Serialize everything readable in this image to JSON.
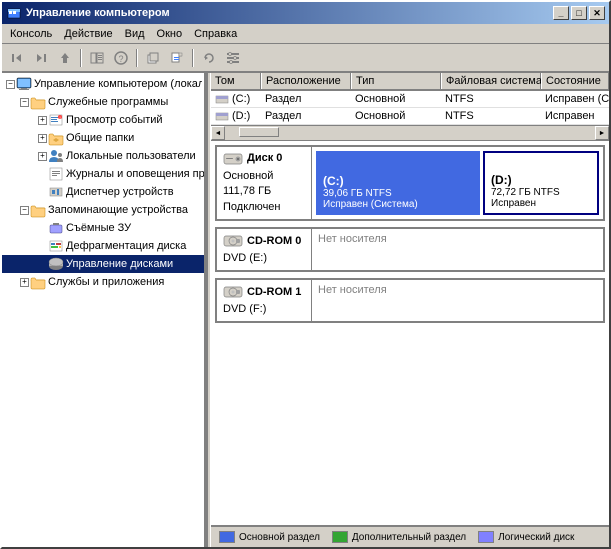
{
  "window": {
    "title": "Управление компьютером",
    "minimize_label": "_",
    "maximize_label": "□",
    "close_label": "✕"
  },
  "menu": {
    "items": [
      "Консоль",
      "Действие",
      "Вид",
      "Окно",
      "Справка"
    ]
  },
  "toolbar": {
    "buttons": [
      "←",
      "→",
      "↑",
      "⊞",
      "?",
      "▦",
      "▶",
      "⟳",
      "⊡"
    ]
  },
  "tree": {
    "root_label": "Управление компьютером (локал.",
    "items": [
      {
        "label": "Служебные программы",
        "level": 1,
        "expanded": true,
        "has_children": true
      },
      {
        "label": "Просмотр событий",
        "level": 2,
        "expanded": false,
        "has_children": true
      },
      {
        "label": "Общие папки",
        "level": 2,
        "expanded": false,
        "has_children": true
      },
      {
        "label": "Локальные пользователи",
        "level": 2,
        "expanded": false,
        "has_children": true
      },
      {
        "label": "Журналы и оповещения пр",
        "level": 2,
        "expanded": false,
        "has_children": false
      },
      {
        "label": "Диспетчер устройств",
        "level": 2,
        "expanded": false,
        "has_children": false
      },
      {
        "label": "Запоминающие устройства",
        "level": 1,
        "expanded": true,
        "has_children": true
      },
      {
        "label": "Съёмные ЗУ",
        "level": 2,
        "expanded": false,
        "has_children": false
      },
      {
        "label": "Дефрагментация диска",
        "level": 2,
        "expanded": false,
        "has_children": false
      },
      {
        "label": "Управление дисками",
        "level": 2,
        "expanded": false,
        "has_children": false,
        "selected": true
      },
      {
        "label": "Службы и приложения",
        "level": 1,
        "expanded": false,
        "has_children": true
      }
    ]
  },
  "table": {
    "headers": [
      "Том",
      "Расположение",
      "Тип",
      "Файловая система",
      "Состояние"
    ],
    "rows": [
      {
        "icon": true,
        "tom": "(C:)",
        "rasp": "Раздел",
        "tip": "Основной",
        "fs": "NTFS",
        "state": "Исправен (Систем"
      },
      {
        "icon": true,
        "tom": "(D:)",
        "rasp": "Раздел",
        "tip": "Основной",
        "fs": "NTFS",
        "state": "Исправен"
      }
    ]
  },
  "disks": [
    {
      "id": "disk0",
      "name": "Диск 0",
      "type": "Основной",
      "size": "111,78 ГБ",
      "status": "Подключен",
      "partitions": [
        {
          "id": "c",
          "label": "(C:)",
          "size": "39,06 ГБ NTFS",
          "status": "Исправен (Система)",
          "style": "primary"
        },
        {
          "id": "d",
          "label": "(D:)",
          "size": "72,72 ГБ NTFS",
          "status": "Исправен",
          "style": "selected"
        }
      ]
    }
  ],
  "cdrom": [
    {
      "id": "cdrom0",
      "name": "CD-ROM 0",
      "type": "DVD (E:)",
      "status": "Нет носителя"
    },
    {
      "id": "cdrom1",
      "name": "CD-ROM 1",
      "type": "DVD (F:)",
      "status": "Нет носителя"
    }
  ],
  "legend": [
    {
      "color": "#4169e1",
      "label": "Основной раздел"
    },
    {
      "color": "#33a533",
      "label": "Дополнительный раздел"
    },
    {
      "color": "#8080ff",
      "label": "Логический диск"
    }
  ]
}
